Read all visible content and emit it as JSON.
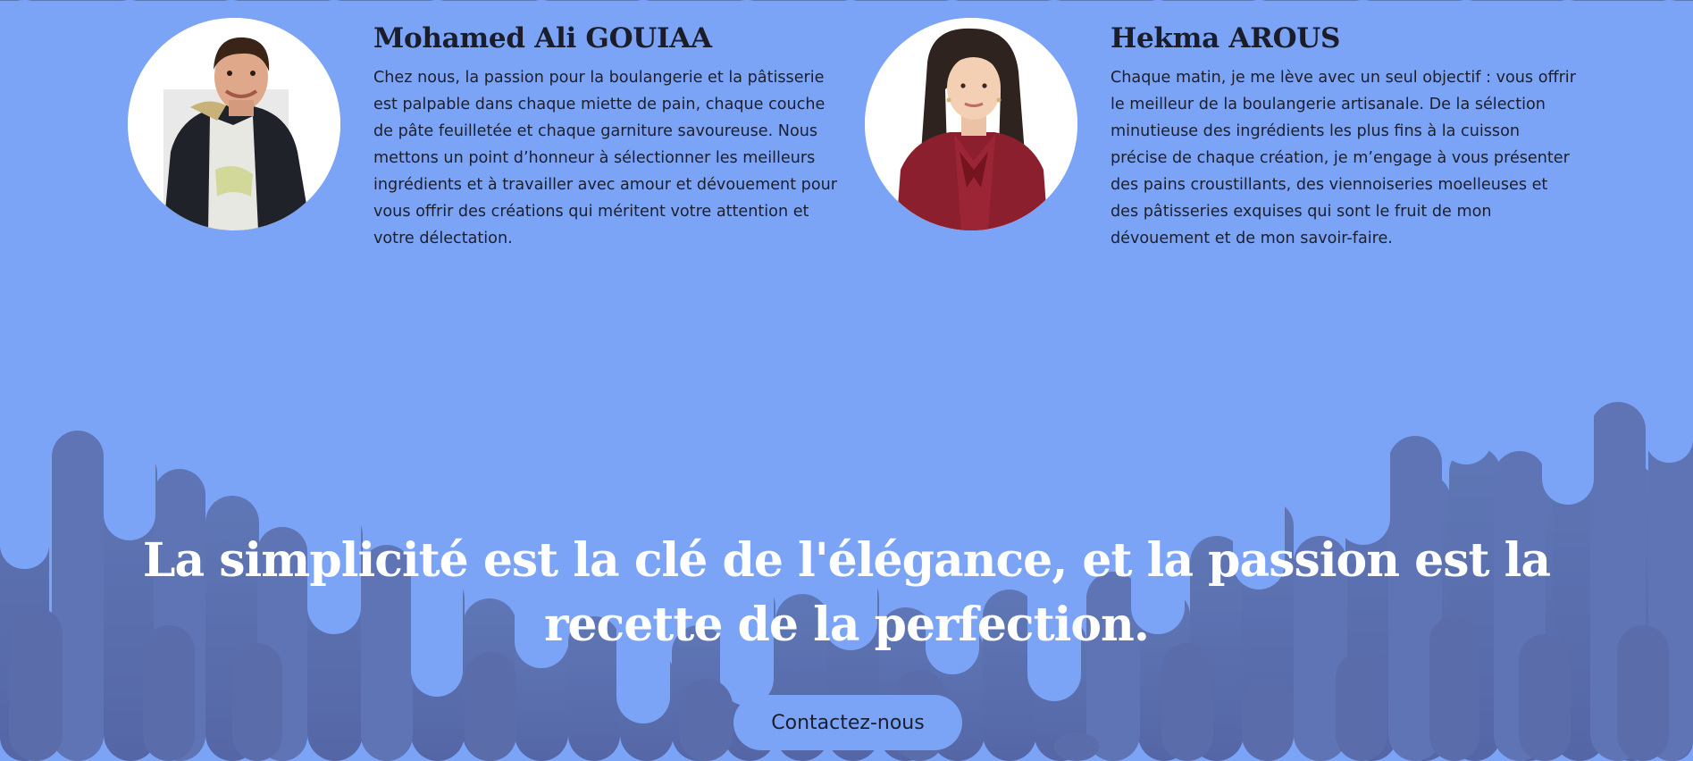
{
  "team": [
    {
      "name": "Mohamed Ali GOUIAA",
      "bio": "Chez nous, la passion pour la boulangerie et la pâtisserie est palpable dans chaque miette de pain, chaque couche de pâte feuilletée et chaque garniture savoureuse. Nous mettons un point d’honneur à sélectionner les meilleurs ingrédients et à travailler avec amour et dévouement pour vous offrir des créations qui méritent votre attention et votre délectation."
    },
    {
      "name": "Hekma AROUS",
      "bio": "Chaque matin, je me lève avec un seul objectif : vous offrir le meilleur de la boulangerie artisanale. De la sélection minutieuse des ingrédients les plus fins à la cuisson précise de chaque création, je m’engage à vous présenter des pains croustillants, des viennoiseries moelleuses et des pâtisseries exquises qui sont le fruit de mon dévouement et de mon savoir-faire."
    }
  ],
  "hero": {
    "quote": "La simplicité est la clé de l'élégance, et la passion est la recette de la perfection.",
    "cta_label": "Contactez-nous"
  },
  "colors": {
    "background": "#7ba4f6",
    "drip_dark": "#5a6fad",
    "drip_mid": "#6883c4",
    "text_dark": "#1c1d2b",
    "quote_text": "#ffffff"
  },
  "icons": {
    "avatar_1": "man-portrait-photo",
    "avatar_2": "woman-portrait-photo"
  }
}
